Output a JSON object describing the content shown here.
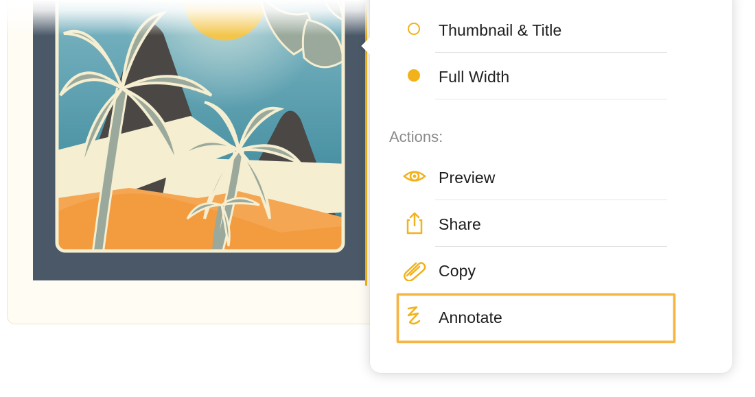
{
  "colors": {
    "accent": "#f2b21b",
    "highlight": "#f6b441",
    "mat": "#4a5868"
  },
  "view_options": [
    {
      "label": "Thumbnail & Title",
      "selected": false
    },
    {
      "label": "Full Width",
      "selected": true
    }
  ],
  "actions_header": "Actions:",
  "actions": [
    {
      "label": "Preview",
      "icon": "eye-icon"
    },
    {
      "label": "Share",
      "icon": "share-icon"
    },
    {
      "label": "Copy",
      "icon": "paperclip-icon"
    },
    {
      "label": "Annotate",
      "icon": "markup-squiggle-icon",
      "highlighted": true
    }
  ]
}
